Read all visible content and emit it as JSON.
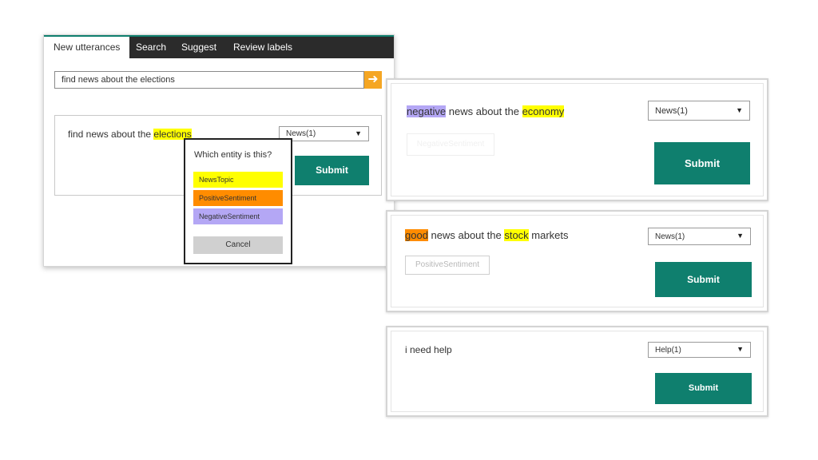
{
  "left_window": {
    "tabs": [
      {
        "label": "New utterances"
      },
      {
        "label": "Search"
      },
      {
        "label": "Suggest"
      },
      {
        "label": "Review labels"
      }
    ],
    "search_value": "find news about the elections",
    "search_go_icon": "arrow-right-icon",
    "card": {
      "utterance_prefix": "find news about the ",
      "utterance_highlight": "elections",
      "intent_selected": "News(1)",
      "submit_label": "Submit"
    },
    "popup": {
      "title": "Which entity is this?",
      "options": [
        {
          "label": "NewsTopic",
          "color": "#ffff00"
        },
        {
          "label": "PositiveSentiment",
          "color": "#ff8c00"
        },
        {
          "label": "NegativeSentiment",
          "color": "#b4a7f5"
        }
      ],
      "cancel_label": "Cancel"
    }
  },
  "right_cards": [
    {
      "segments": [
        "negative",
        " news about the ",
        "economy"
      ],
      "intent_selected": "News(1)",
      "entity_chip": "NegativeSentiment",
      "submit_label": "Submit"
    },
    {
      "segments": [
        "good",
        " news about the ",
        "stock",
        " markets"
      ],
      "intent_selected": "News(1)",
      "entity_chip": "PositiveSentiment",
      "submit_label": "Submit"
    },
    {
      "text": "i need help",
      "intent_selected": "Help(1)",
      "submit_label": "Submit"
    }
  ],
  "colors": {
    "accent": "#0f7f6e",
    "news_topic": "#ffff00",
    "positive": "#ff8c00",
    "negative": "#b4a7f5",
    "go_button": "#f5a623"
  }
}
